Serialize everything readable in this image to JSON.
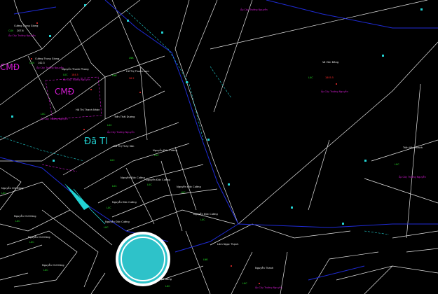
{
  "zone_labels": {
    "cmd_top_left": "CMĐ",
    "cmd_center": "CMĐ",
    "land_class": "Đã Tl"
  },
  "parcels": [
    {
      "id": "p-truong-giang",
      "owner": "Cường Trung Giang",
      "code": "CLN",
      "area": "207.6",
      "sub": "Ấp Cây Trường Nguyễn"
    },
    {
      "id": "p-truong-giang-2",
      "owner": "Cường Trung Giang",
      "code": "CLN",
      "area": "142.3",
      "sub": "Ấp Cây Trường Nguyễn"
    },
    {
      "id": "p-thanh-phong",
      "owner": "Nguyễn Thanh Phong",
      "code": "LUC",
      "area": "184.5",
      "sub": "Ấp Cây Trường Nguyễn"
    },
    {
      "id": "p-thanh-lam",
      "owner": "Hồ Thị Thanh Lam",
      "code": "LNK",
      "area": "96.2",
      "sub": ""
    },
    {
      "id": "p-thanh-phong-2",
      "owner": "Nguyễn Thanh Phong",
      "code": "LNK",
      "area": "",
      "sub": ""
    },
    {
      "id": "p-thanh-nhan",
      "owner": "Hồ Thị Thanh Nhàn",
      "code": "LUC",
      "area": "",
      "sub": "Ấp Cây Trường Nguyễn"
    },
    {
      "id": "p-thai-duong",
      "owner": "Trần Thái Dương",
      "code": "LUC",
      "area": "",
      "sub": "Ấp Cây Trường Nguyễn"
    },
    {
      "id": "p-thuy-van",
      "owner": "Đỗ Thị Thủy Vân",
      "code": "LUC",
      "area": "",
      "sub": ""
    },
    {
      "id": "p-duc-cuong-1",
      "owner": "Nguyễn Đức Cường",
      "code": "LUC",
      "area": "",
      "sub": ""
    },
    {
      "id": "p-duc-cuong-2",
      "owner": "Nguyễn Đức Cường",
      "code": "LUC",
      "area": "",
      "sub": ""
    },
    {
      "id": "p-duc-cuong-3",
      "owner": "Nguyễn Đức Cường",
      "code": "LUC",
      "area": "",
      "sub": ""
    },
    {
      "id": "p-duc-cuong-4",
      "owner": "Nguyễn Đức Cường",
      "code": "LUC",
      "area": "",
      "sub": ""
    },
    {
      "id": "p-duc-cuong-5",
      "owner": "Nguyễn Đức Cường",
      "code": "LUC",
      "area": "",
      "sub": ""
    },
    {
      "id": "p-duc-cuong-6",
      "owner": "Nguyễn Đức Cường",
      "code": "LUC",
      "area": "",
      "sub": ""
    },
    {
      "id": "p-duc-cuong-7",
      "owner": "Nguyễn Đức Cường",
      "code": "LUC",
      "area": "",
      "sub": ""
    },
    {
      "id": "p-chi-dung-1",
      "owner": "Nguyễn Chí Dũng",
      "code": "LUC",
      "area": "",
      "sub": ""
    },
    {
      "id": "p-chi-dung-2",
      "owner": "Nguyễn Chí Dũng",
      "code": "LUC",
      "area": "",
      "sub": ""
    },
    {
      "id": "p-chi-dung-3",
      "owner": "Nguyễn Chí Dũng",
      "code": "LUC",
      "area": "",
      "sub": ""
    },
    {
      "id": "p-chi-dung-4",
      "owner": "Nguyễn Chí Dũng",
      "code": "LUC",
      "area": "",
      "sub": ""
    },
    {
      "id": "p-vo-van-dang",
      "owner": "Võ Văn Đăng",
      "code": "LUC",
      "area": "1805.5",
      "sub": "Ấp Cây Trường Nguyễn"
    },
    {
      "id": "p-tran-van-thanh",
      "owner": "Trần Văn Thành",
      "code": "LUC",
      "area": "",
      "sub": "Ấp Cây Trường Nguyễn"
    },
    {
      "id": "p-lam-ngoc-thanh",
      "owner": "Lâm Ngọc Thạnh",
      "code": "LNK",
      "area": "",
      "sub": ""
    },
    {
      "id": "p-nguyen-thanh",
      "owner": "Nguyễn Thanh",
      "code": "LUC",
      "area": "",
      "sub": "Ấp Cây Trường Nguyễn"
    },
    {
      "id": "p-le-dung",
      "owner": "Lê Dũng",
      "code": "LUC",
      "area": "",
      "sub": ""
    }
  ],
  "top_note": "Ấp Cây Trường Nguyễn",
  "colors": {
    "background": "#000000",
    "parcel_line": "#e6e6e6",
    "boundary": "#1f2bd6",
    "cyan": "#22d3d3",
    "magenta": "#d21bd2",
    "cursor": "#2ec2c9"
  },
  "icons": {
    "cursor": "circle-cursor-icon",
    "pointer": "arrow-pointer-icon"
  }
}
